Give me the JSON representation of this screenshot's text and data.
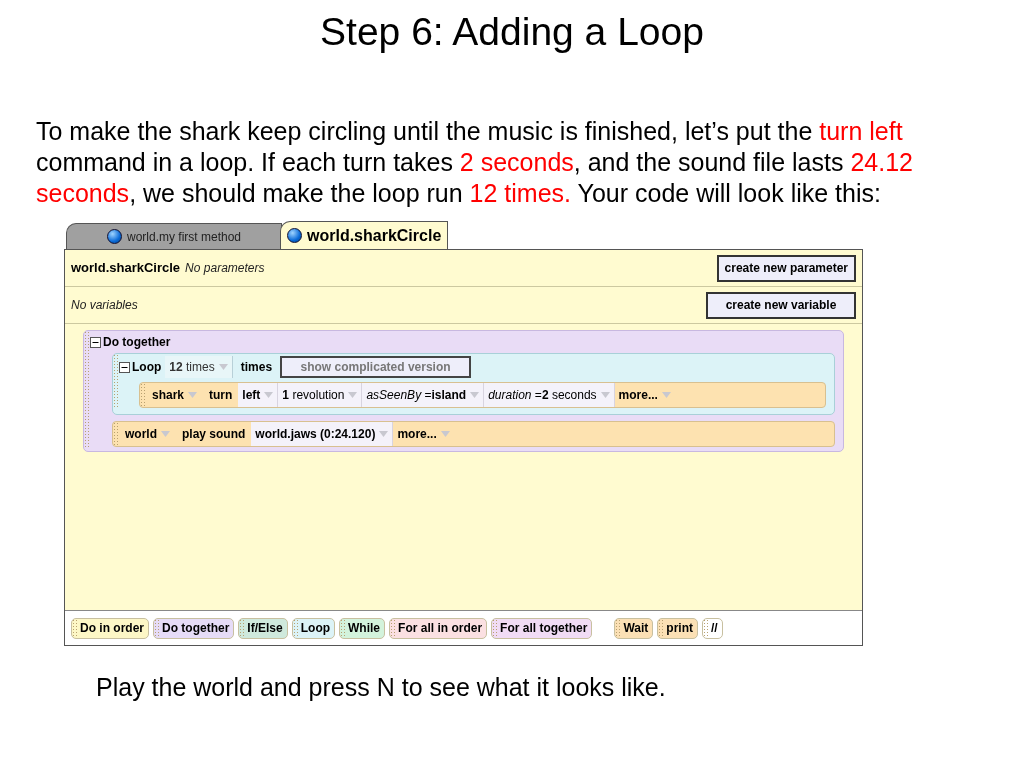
{
  "slide_title": "Step 6: Adding a Loop",
  "intro": [
    {
      "text": "To make the shark keep circling until the music is finished, let’s put the ",
      "highlight": false
    },
    {
      "text": "turn left",
      "highlight": true
    },
    {
      "text": " command in a loop. If each turn takes ",
      "highlight": false
    },
    {
      "text": "2 seconds",
      "highlight": true
    },
    {
      "text": ", and the sound file lasts ",
      "highlight": false
    },
    {
      "text": "24.12 seconds",
      "highlight": true
    },
    {
      "text": ", we should make the loop run ",
      "highlight": false
    },
    {
      "text": "12 times.",
      "highlight": true
    },
    {
      "text": " Your code will look like this:",
      "highlight": false
    }
  ],
  "editor": {
    "tabs": [
      {
        "label": "world.my first method",
        "selected": false
      },
      {
        "label": "world.sharkCircle",
        "selected": true
      }
    ],
    "method_name": "world.sharkCircle",
    "parameters_note": "No parameters",
    "parameter_button": "create new parameter",
    "variables_note": "No variables",
    "variable_button": "create new variable",
    "do_together": {
      "expanded": true,
      "label": "Do together",
      "loop": {
        "expanded": true,
        "label": "Loop",
        "count": "**12** times",
        "times_label": "times",
        "toggle_button": "show complicated version",
        "statements": [
          {
            "parts": [
              {
                "kind": "object",
                "text": "shark"
              },
              {
                "kind": "method",
                "text": "turn"
              },
              {
                "kind": "arg",
                "text": "**left**"
              },
              {
                "kind": "arg",
                "text": "**1** revolution"
              },
              {
                "kind": "arg",
                "text": "*asSeenBy* =**island**"
              },
              {
                "kind": "arg",
                "text": "*duration* =**2** seconds"
              },
              {
                "kind": "more",
                "text": "more..."
              }
            ]
          }
        ]
      },
      "statements": [
        {
          "parts": [
            {
              "kind": "object",
              "text": "world"
            },
            {
              "kind": "method",
              "text": "play sound"
            },
            {
              "kind": "arg",
              "text": "**world.jaws (0:24.120)**"
            },
            {
              "kind": "more",
              "text": "more..."
            }
          ]
        }
      ]
    },
    "tiles": [
      {
        "label": "Do in order",
        "color": "#fdf7c6"
      },
      {
        "label": "Do together",
        "color": "#e6dcf7"
      },
      {
        "label": "If/Else",
        "color": "#cfe9dc"
      },
      {
        "label": "Loop",
        "color": "#dcf3f7"
      },
      {
        "label": "While",
        "color": "#d3f3dc"
      },
      {
        "label": "For all in order",
        "color": "#fbe0e2"
      },
      {
        "label": "For all together",
        "color": "#f1dcf5"
      },
      {
        "label": "Wait",
        "color": "#fbe0b5",
        "gap": true
      },
      {
        "label": "print",
        "color": "#fbe0b5"
      },
      {
        "label": "//",
        "color": "#ffffff"
      }
    ]
  },
  "footer_note": "Play the world and press N to see what it looks like."
}
